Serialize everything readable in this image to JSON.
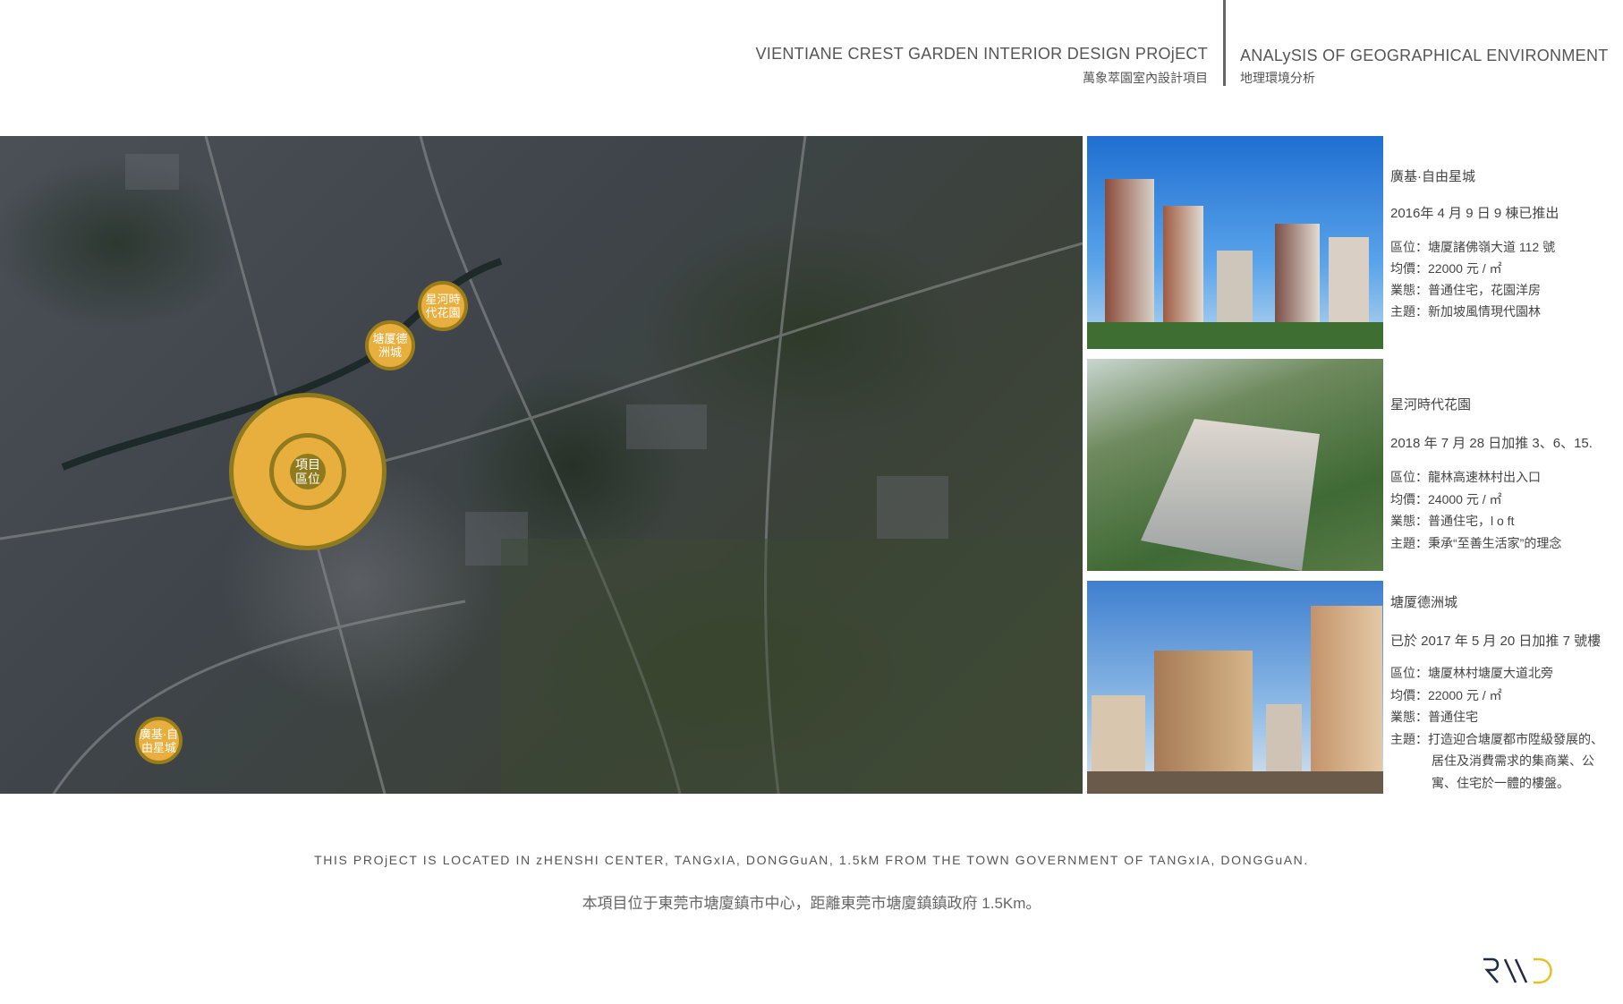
{
  "header": {
    "project_en": "VIENTIANE CREST GARDEN INTERIOR DESIGN PROjECT",
    "project_cn": "萬象萃園室內設計項目",
    "section_en": "ANALySIS OF GEOGRAPHICAL ENVIRONMENT",
    "section_cn": "地理環境分析"
  },
  "map": {
    "project_marker": "項目\n區位",
    "markers": [
      {
        "label": "星河時\n代花園"
      },
      {
        "label": "塘厦德\n洲城"
      },
      {
        "label": "廣基·自\n由星城"
      }
    ]
  },
  "projects": [
    {
      "name": "廣基·自由星城",
      "date": "2016年 4 月 9 日 9 棟已推出",
      "lines": [
        "區位：塘厦諸佛嶺大道 112 號",
        "均價：22000 元 / ㎡",
        "業態：普通住宅，花園洋房",
        "主題：新加坡風情現代園林"
      ]
    },
    {
      "name": "星河時代花園",
      "date": "2018 年 7 月 28 日加推 3、6、15.",
      "lines": [
        "區位：龍林高速林村出入口",
        "均價：24000 元 / ㎡",
        "業態：普通住宅，l o ft",
        "主題：秉承“至善生活家”的理念"
      ]
    },
    {
      "name": "塘厦德洲城",
      "date": "已於 2017 年 5 月 20 日加推 7 號樓",
      "lines": [
        "區位：塘厦林村塘厦大道北旁",
        "均價：22000 元 / ㎡",
        "業態：普通住宅",
        "主題：打造迎合塘厦都市陞級發展的、",
        "居住及消費需求的集商業、公",
        "寓、住宅於一體的樓盤。"
      ]
    }
  ],
  "footer": {
    "en": "THIS PROjECT IS LOCATED IN zHENSHI CENTER, TANGxIA, DONGGuAN, 1.5kM FROM THE TOWN GOVERNMENT OF TANGxIA, DONGGuAN.",
    "cn": "本項目位于東莞市塘廈鎮市中心，距離東莞市塘廈鎮鎮政府 1.5Km。"
  },
  "logo": "RWD",
  "colors": {
    "marker": "#e8af3e",
    "marker_border": "#8f7a1e"
  }
}
